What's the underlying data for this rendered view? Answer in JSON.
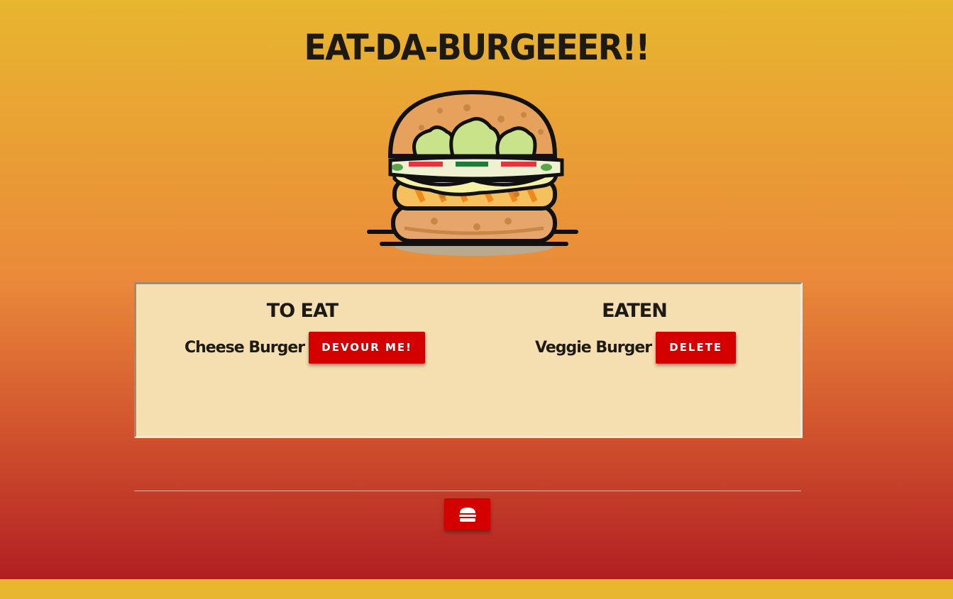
{
  "header": {
    "title": "EAT-DA-BURGEEER!!"
  },
  "logo": {
    "icon": "burger-logo-icon"
  },
  "to_eat": {
    "heading": "TO EAT",
    "items": [
      {
        "name": "Cheese Burger",
        "button_label": "DEVOUR ME!"
      }
    ]
  },
  "eaten": {
    "heading": "EATEN",
    "items": [
      {
        "name": "Veggie Burger",
        "button_label": "DELETE"
      }
    ]
  },
  "footer": {
    "add_button_icon": "hamburger-icon"
  },
  "colors": {
    "gradient_top": "#e8b62f",
    "gradient_mid": "#ea8a3a",
    "gradient_bottom": "#b11e22",
    "panel": "#f5deb0",
    "button": "#d40000",
    "text": "#1d1a12"
  }
}
